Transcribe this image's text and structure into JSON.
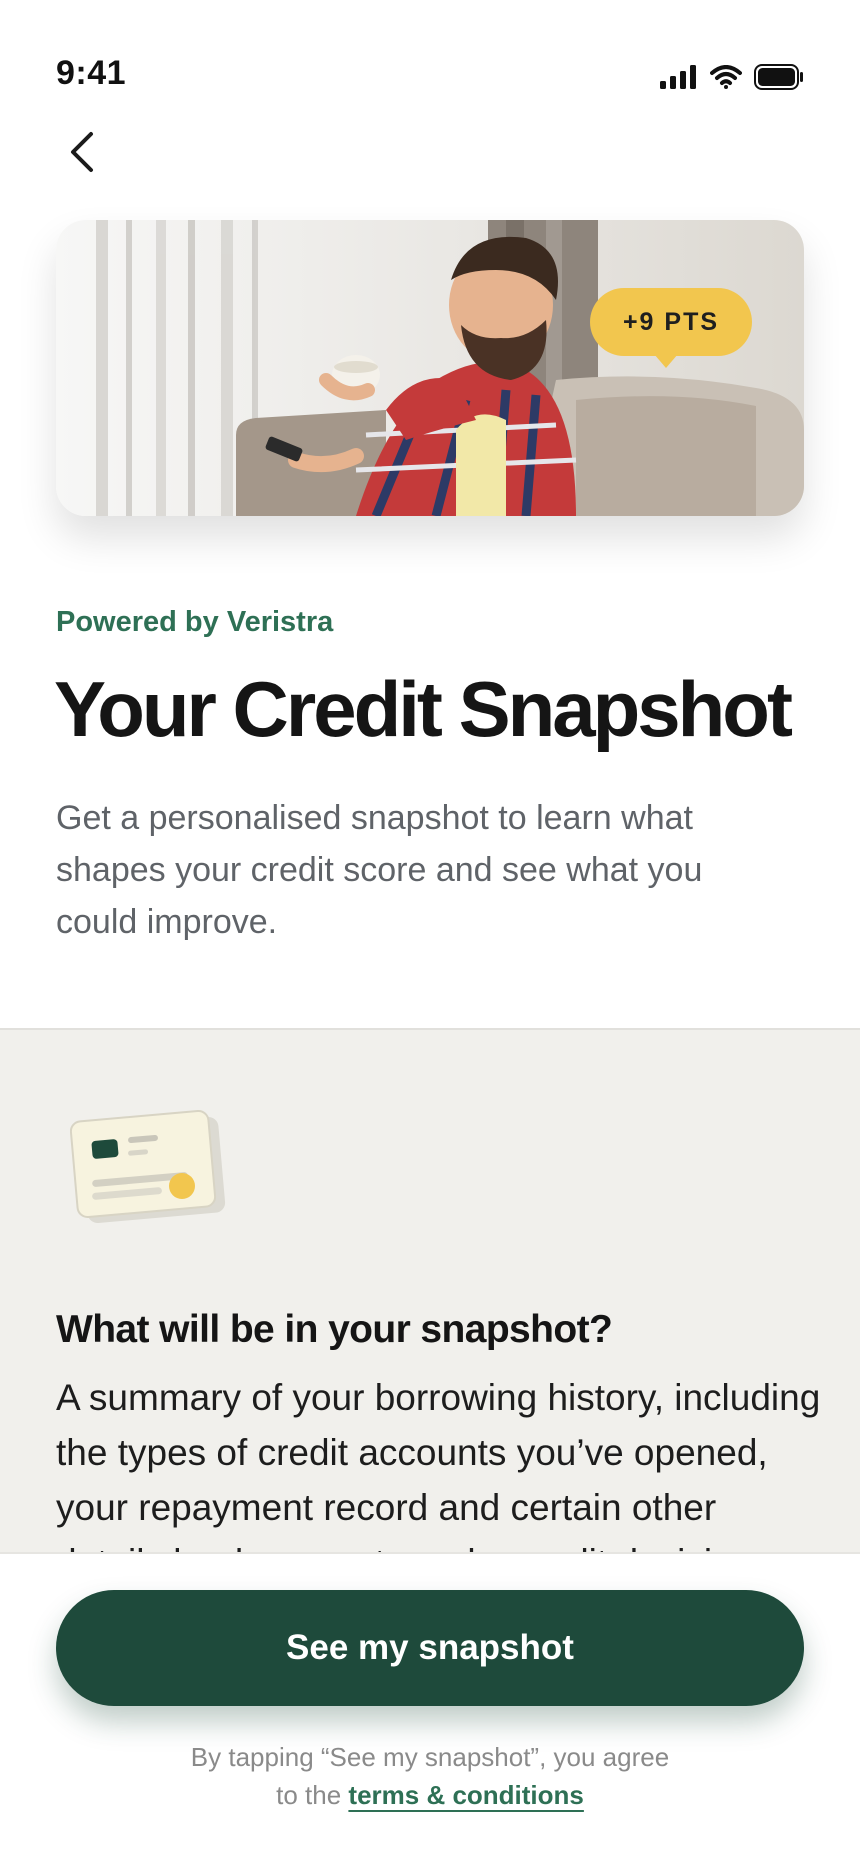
{
  "status_bar": {
    "time": "9:41",
    "icons": [
      "cellular-signal-icon",
      "wifi-icon",
      "battery-icon"
    ]
  },
  "nav": {
    "back_icon": "chevron-left-icon"
  },
  "hero": {
    "badge_text": "+9 PTS",
    "badge_color": "#f2c64e"
  },
  "intro": {
    "powered_by": "Powered by Veristra",
    "title": "Your Credit Snapshot",
    "description": "Get a personalised snapshot to learn what shapes your credit score and see what you could improve."
  },
  "info": {
    "illustration_icon": "credit-card-stack-icon",
    "heading": "What will be in your snapshot?",
    "body": "A summary of your borrowing history, including the types of credit accounts you’ve opened, your repayment record and certain other details lenders use to make credit decisions."
  },
  "footer": {
    "button_label": "See my snapshot",
    "disclaimer_prefix": "By tapping “See my snapshot”, you agree",
    "disclaimer_to": "to the",
    "terms_label": "terms & conditions"
  },
  "colors": {
    "accent_green": "#2e7055",
    "button_green": "#1e4a3b",
    "section_bg": "#f1f0ec",
    "badge_yellow": "#f2c64e"
  }
}
